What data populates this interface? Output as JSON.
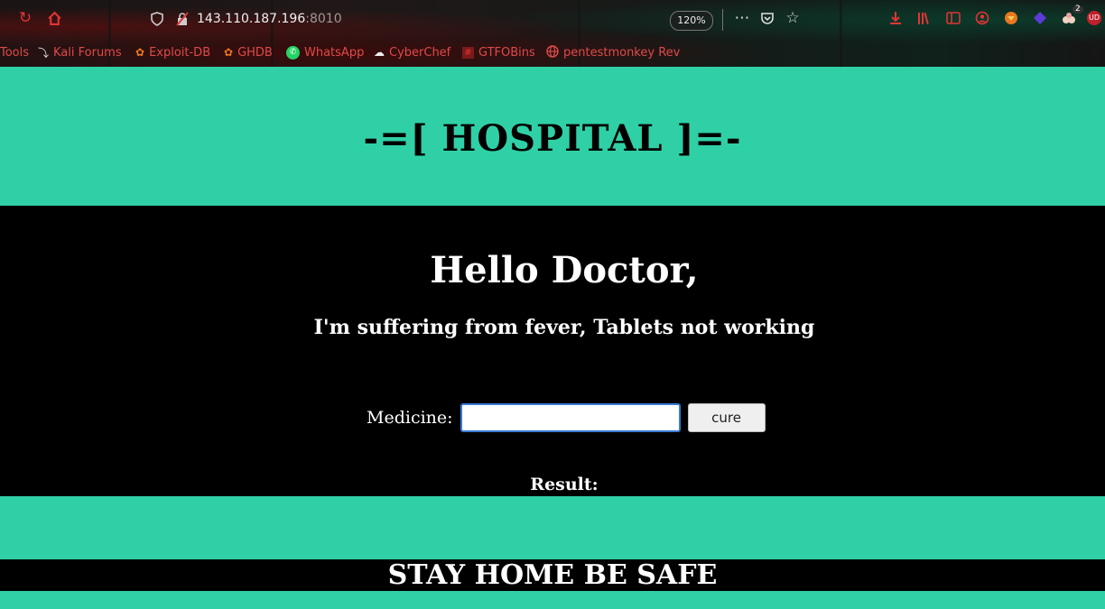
{
  "browser": {
    "url_host": "143.110.187.196",
    "url_port": ":8010",
    "zoom": "120%",
    "toolbar_icons": [
      "reload-icon",
      "home-icon",
      "shield-icon",
      "insecure-lock-icon",
      "more-icon",
      "pocket-icon",
      "bookmark-star-icon",
      "download-icon",
      "library-icon",
      "sidebar-icon",
      "account-icon",
      "extension-fox-icon",
      "extension-diamond-icon",
      "extension-cookie-icon",
      "extension-ud-icon"
    ],
    "extension_badge": "2",
    "extension_ud_label": "UD",
    "bookmarks": [
      {
        "label": "Tools",
        "icon": "folder-icon"
      },
      {
        "label": "Kali Forums",
        "icon": "kali-dragon-icon"
      },
      {
        "label": "Exploit-DB",
        "icon": "exploit-db-icon"
      },
      {
        "label": "GHDB",
        "icon": "ghdb-icon"
      },
      {
        "label": "WhatsApp",
        "icon": "whatsapp-icon"
      },
      {
        "label": "CyberChef",
        "icon": "chef-hat-icon"
      },
      {
        "label": "GTFOBins",
        "icon": "hash-icon"
      },
      {
        "label": "pentestmonkey Rev",
        "icon": "globe-icon"
      }
    ]
  },
  "page": {
    "title": "-=[ HOSPITAL ]=-",
    "greeting": "Hello Doctor,",
    "complaint": "I'm suffering from fever, Tablets not working",
    "form": {
      "label": "Medicine:",
      "input_value": "",
      "button_label": "cure"
    },
    "result_label": "Result:",
    "result_value": "",
    "footer": "STAY HOME BE SAFE"
  },
  "colors": {
    "accent": "#2fd0a5",
    "dark": "#000000",
    "browser_icon": "#e03535"
  }
}
